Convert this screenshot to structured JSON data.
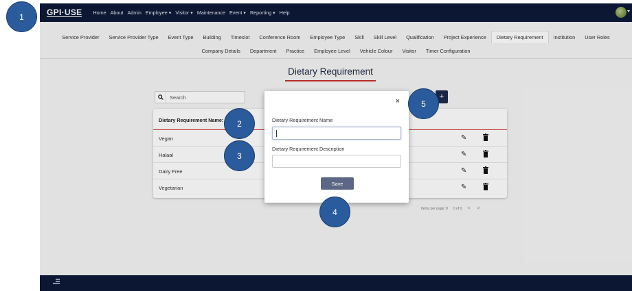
{
  "topbar": {
    "brand": "GPI·USE",
    "nav": [
      "Home",
      "About",
      "Admin",
      "Employee ▾",
      "Visitor ▾",
      "Maintenance",
      "Event ▾",
      "Reporting ▾",
      "Help"
    ]
  },
  "subnav": {
    "row1": [
      "Service Provider",
      "Service Provider Type",
      "Event Type",
      "Building",
      "Timeslot",
      "Conference Room",
      "Employee Type",
      "Skill",
      "Skill Level",
      "Qualification",
      "Project Experience",
      "Dietary Requirement",
      "Institution",
      "User Roles"
    ],
    "row2": [
      "Company Details",
      "Department",
      "Practice",
      "Employee Level",
      "Vehicle Colour",
      "Visitor",
      "Timer Configuration"
    ],
    "active": "Dietary Requirement"
  },
  "page": {
    "title": "Dietary Requirement",
    "search_placeholder": "Search",
    "add_label": "+"
  },
  "table": {
    "header": "Dietary Requirement Name:",
    "rows": [
      "Vegan",
      "Halaal",
      "Dairy Free",
      "Vegetarian"
    ]
  },
  "paginator": {
    "items_per_page": "Items per page: 8",
    "range": "0 of 0",
    "prev": "<",
    "next": ">"
  },
  "modal": {
    "close": "×",
    "name_label": "Dietary Requirement Name",
    "description_label": "Dietary Requirement Description",
    "save_label": "Save"
  },
  "callouts": [
    "1",
    "2",
    "3",
    "4",
    "5"
  ],
  "colors": {
    "navbar": "#0e1a38",
    "accent_red": "#c9302c",
    "save_button": "#5c6785",
    "callout_blue": "#2a5b9c"
  }
}
